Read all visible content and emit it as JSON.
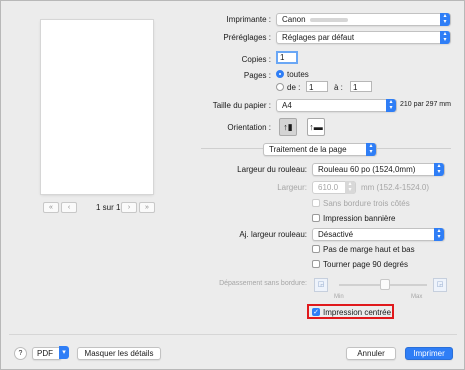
{
  "printer": {
    "label": "Imprimante :",
    "value": "Canon"
  },
  "presets": {
    "label": "Préréglages :",
    "value": "Réglages par défaut"
  },
  "copies": {
    "label": "Copies :",
    "value": "1"
  },
  "pages": {
    "label": "Pages :",
    "all": "toutes",
    "from": "de :",
    "from_value": "1",
    "to": "à :",
    "to_value": "1"
  },
  "paper_size": {
    "label": "Taille du papier :",
    "value": "A4",
    "dims": "210 par 297 mm"
  },
  "orientation": {
    "label": "Orientation :"
  },
  "section": {
    "value": "Traitement de la page"
  },
  "roll_width": {
    "label": "Largeur du rouleau:",
    "value": "Rouleau 60 po (1524,0mm)"
  },
  "width": {
    "label": "Largeur:",
    "value": "610.0",
    "unit": "mm (152.4-1524.0)"
  },
  "options": {
    "no_border": "Sans bordure trois côtés",
    "banner": "Impression bannière",
    "adjust_label": "Aj. largeur rouleau:",
    "adjust_value": "Désactivé",
    "no_margin": "Pas de marge haut et bas",
    "rotate": "Tourner page 90 degrés"
  },
  "overflow": {
    "label": "Dépassement sans bordure:",
    "min": "Min",
    "max": "Max",
    "level": 0.52
  },
  "centered": {
    "label": "Impression centrée",
    "checked": true
  },
  "pager": {
    "text": "1 sur 1"
  },
  "bottom": {
    "help": "?",
    "pdf": "PDF",
    "details": "Masquer les détails",
    "cancel": "Annuler",
    "print": "Imprimer"
  }
}
